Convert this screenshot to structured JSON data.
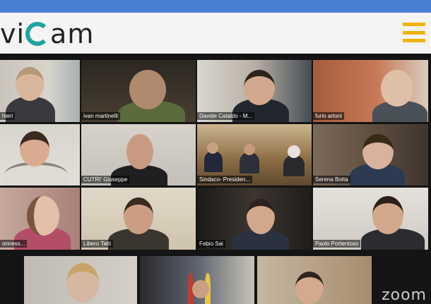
{
  "brand": {
    "logo_text_left": "vi",
    "logo_text_right": "am"
  },
  "participants": [
    {
      "name": "hieri"
    },
    {
      "name": "ivan martinelli"
    },
    {
      "name": "Davide Cataldo - M..."
    },
    {
      "name": "furio artoni"
    },
    {
      "name": ""
    },
    {
      "name": "CUTRI' Giuseppe"
    },
    {
      "name": "Sindaco- Presiden..."
    },
    {
      "name": "Serena Botta"
    },
    {
      "name": "onness..."
    },
    {
      "name": "Libero Tatti"
    },
    {
      "name": "Fabio Sai"
    },
    {
      "name": "Paolo Portentoso"
    }
  ],
  "watermark": "zoom",
  "colors": {
    "topbar": "#4a7fd6",
    "accent": "#1fa3a0",
    "menu": "#f0b400",
    "active_speaker": "#79d14a"
  }
}
